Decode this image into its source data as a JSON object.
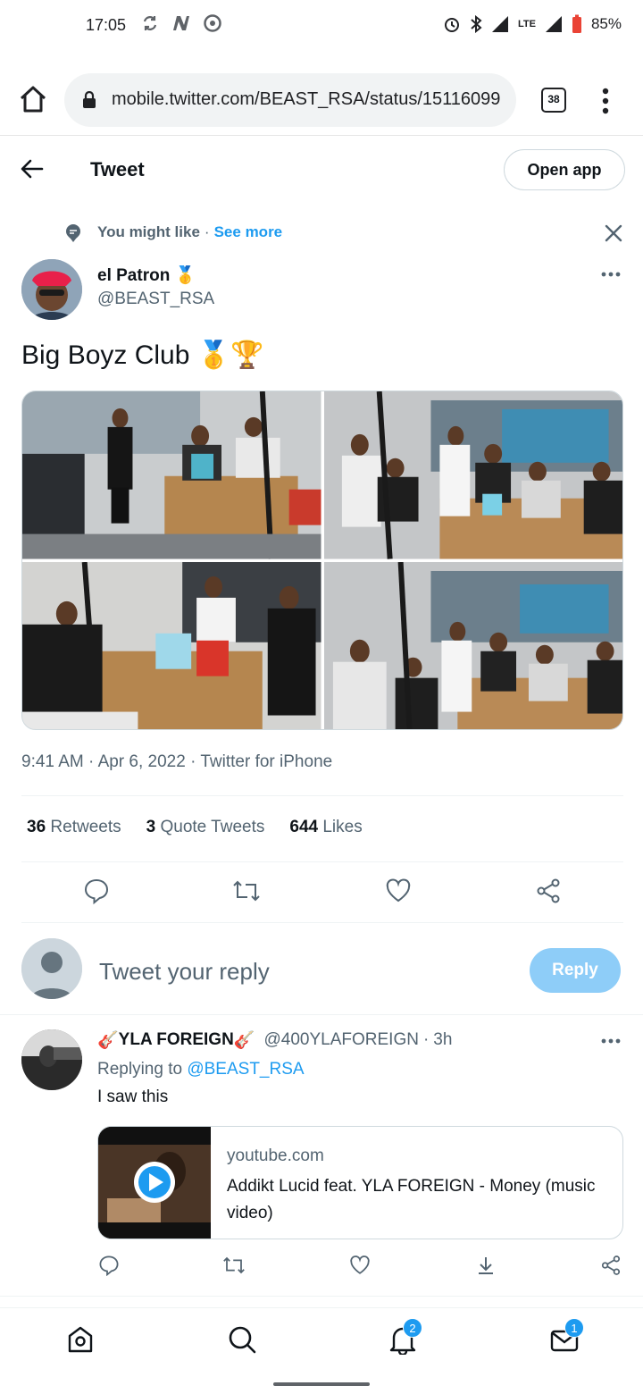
{
  "status_bar": {
    "time": "17:05",
    "network": "LTE",
    "battery": "85%"
  },
  "browser": {
    "url": "mobile.twitter.com/BEAST_RSA/status/15116099",
    "tab_count": "38"
  },
  "header": {
    "title": "Tweet",
    "open_app": "Open app"
  },
  "suggestion": {
    "label": "You might like",
    "separator": "·",
    "link": "See more"
  },
  "tweet": {
    "author_name": "el Patron",
    "author_emoji": "🥇",
    "author_handle": "@BEAST_RSA",
    "text": "Big Boyz Club",
    "text_emojis": "🥇🏆",
    "time": "9:41 AM",
    "date": "Apr 6, 2022",
    "source": "Twitter for iPhone",
    "stats": {
      "retweets_count": "36",
      "retweets_label": "Retweets",
      "quotes_count": "3",
      "quotes_label": "Quote Tweets",
      "likes_count": "644",
      "likes_label": "Likes"
    }
  },
  "composer": {
    "placeholder": "Tweet your reply",
    "button": "Reply"
  },
  "reply_tweet": {
    "name_prefix_emoji": "🎸",
    "name": "YLA FOREIGN",
    "name_suffix_emoji": "🎸",
    "handle": "@400YLAFOREIGN",
    "dot": "·",
    "age": "3h",
    "replying_label": "Replying to",
    "replying_to": "@BEAST_RSA",
    "text": "I saw this",
    "card": {
      "domain": "youtube.com",
      "title": "Addikt Lucid feat. YLA FOREIGN - Money (music video)"
    }
  },
  "bottom_nav": {
    "notifications_badge": "2",
    "messages_badge": "1"
  },
  "colors": {
    "accent": "#1d9bf0",
    "reply_button_disabled": "#8ecdf8",
    "secondary_text": "#536471"
  }
}
